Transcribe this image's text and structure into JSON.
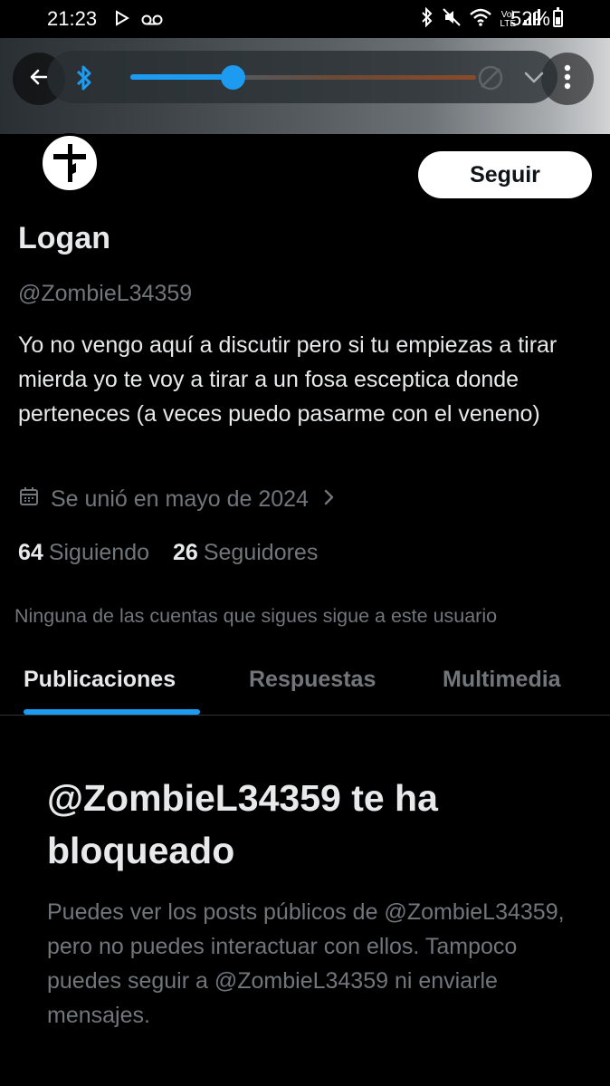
{
  "status_bar": {
    "time": "21:23",
    "battery": "52%",
    "lte_label_top": "Vo)",
    "lte_label_bottom": "LTE"
  },
  "volume_panel": {
    "level_fraction": 0.3,
    "accent_color": "#1d9bf0"
  },
  "profile": {
    "follow_label": "Seguir",
    "name": "Logan",
    "handle": "@ZombieL34359",
    "bio": "Yo no vengo aquí a discutir pero si tu empiezas a tirar mierda yo te voy a tirar a un fosa esceptica donde perteneces (a veces puedo pasarme con el veneno)",
    "joined": "Se unió en mayo de 2024",
    "following_count": "64",
    "following_label": "Siguiendo",
    "followers_count": "26",
    "followers_label": "Seguidores",
    "mutual_note": "Ninguna de las cuentas que sigues sigue a este usuario"
  },
  "tabs": [
    {
      "label": "Publicaciones",
      "active": true
    },
    {
      "label": "Respuestas",
      "active": false
    },
    {
      "label": "Multimedia",
      "active": false
    }
  ],
  "blocked": {
    "title": "@ZombieL34359 te ha bloqueado",
    "body": "Puedes ver los posts públicos de @ZombieL34359, pero no puedes interactuar con ellos. Tampoco puedes seguir a @ZombieL34359 ni enviarle mensajes."
  },
  "icons": [
    "back-arrow-icon",
    "bluetooth-icon",
    "mute-icon",
    "chevron-down-icon",
    "more-vertical-icon",
    "calendar-icon",
    "chevron-right-icon",
    "play-icon",
    "voicemail-icon",
    "wifi-icon",
    "signal-icon",
    "battery-icon"
  ]
}
